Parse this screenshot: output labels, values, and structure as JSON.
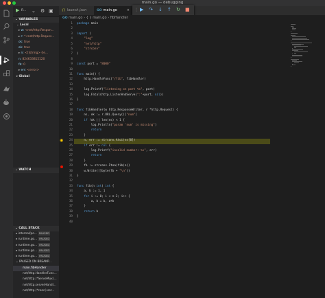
{
  "window": {
    "title": "main.go — debugging"
  },
  "colors": {
    "accent": "#007acc",
    "current_line": "#4b4b18",
    "breakpoint": "#e51400",
    "continue": "#89d185"
  },
  "activity_bar": {
    "icons": [
      "files-icon",
      "search-icon",
      "source-control-icon",
      "debug-icon",
      "extensions-icon",
      "deploy-icon",
      "docker-icon",
      "remote-icon"
    ]
  },
  "debug_toolbar_side": {
    "config_label": "R..."
  },
  "variables": {
    "title": "VARIABLES",
    "local_label": "Local",
    "items": [
      {
        "arrow": "▸",
        "name": "w:",
        "value": "<net/http.Respon..."
      },
      {
        "arrow": "▸",
        "name": "r:",
        "value": "*<net/http.Reques..."
      },
      {
        "arrow": "",
        "name": "ok:",
        "value": "true"
      },
      {
        "arrow": "",
        "name": "ok:",
        "value": "true"
      },
      {
        "arrow": "▸",
        "name": "n:",
        "value": "<[]string> (le..."
      },
      {
        "arrow": "",
        "name": "n:",
        "value": "824633815120"
      },
      {
        "arrow": "",
        "name": "fb:",
        "value": "0"
      },
      {
        "arrow": "▸",
        "name": "err:",
        "value": "<error>"
      }
    ],
    "global_label": "Global"
  },
  "watch": {
    "title": "WATCH"
  },
  "call_stack": {
    "title": "CALL STACK",
    "threads": [
      {
        "label": "internal/po...",
        "badge": "PAUSED"
      },
      {
        "label": "runtime.go...",
        "badge": "PAUSED"
      },
      {
        "label": "runtime.go...",
        "badge": "PAUSED"
      },
      {
        "label": "runtime.go...",
        "badge": "PAUSED"
      },
      {
        "label": "runtime.go...",
        "badge": "PAUSED"
      }
    ],
    "paused_label": "PAUSED ON BREAKP...",
    "frames": [
      "main.fibHandler",
      "net/http.HandlerFunc...",
      "net/http.(*ServeMux)...",
      "net/http.serverHandl...",
      "net/http.(*conn).ser..."
    ]
  },
  "tabs": [
    {
      "icon": "{}",
      "label": "launch.json",
      "active": false
    },
    {
      "icon": "GO",
      "label": "main.go",
      "active": true,
      "close": "×"
    }
  ],
  "breadcrumb": {
    "file": "main.go",
    "sep1": "›",
    "scope": "{ }",
    "func": "main.go",
    "sep2": "›",
    "symbol": "fibHandler"
  },
  "debug_bar": {
    "icons": [
      "▶",
      "↷",
      "↓",
      "↑",
      "↻",
      "■"
    ]
  },
  "code": {
    "lines": [
      "package main",
      "",
      "import (",
      "    \"log\"",
      "    \"net/http\"",
      "    \"strconv\"",
      ")",
      "",
      "const port = \"8000\"",
      "",
      "func main() {",
      "    http.HandleFunc(\"/fib\", fibHandler)",
      "",
      "    log.Printf(\"listening on port %s\", port)",
      "    log.Fatal(http.ListenAndServe(\":\"+port, nil))",
      "}",
      "",
      "func fibHandler(w http.ResponseWriter, r *http.Request) {",
      "    ns, ok := r.URL.Query()[\"num\"]",
      "    if !ok || len(ns) < 1 {",
      "        log.Println(\"param 'num' is missing\")",
      "        return",
      "    }",
      "    n, err := strconv.Atoi(ns[0])",
      "    if err != nil {",
      "        log.Printf(\"invalid number: %v\", err)",
      "        return",
      "    }",
      "    fb := strconv.Itoa(fib(n))",
      "    w.Write([]byte(fb + \"\\n\"))",
      "}",
      "",
      "func fib(n int) int {",
      "    a, b := 1, 1",
      "    for i := 0; i < n-2; i++ {",
      "        a, b = b, a+b",
      "    }",
      "    return b",
      "}",
      ""
    ],
    "current_line": 24,
    "breakpoint_line": 29
  }
}
